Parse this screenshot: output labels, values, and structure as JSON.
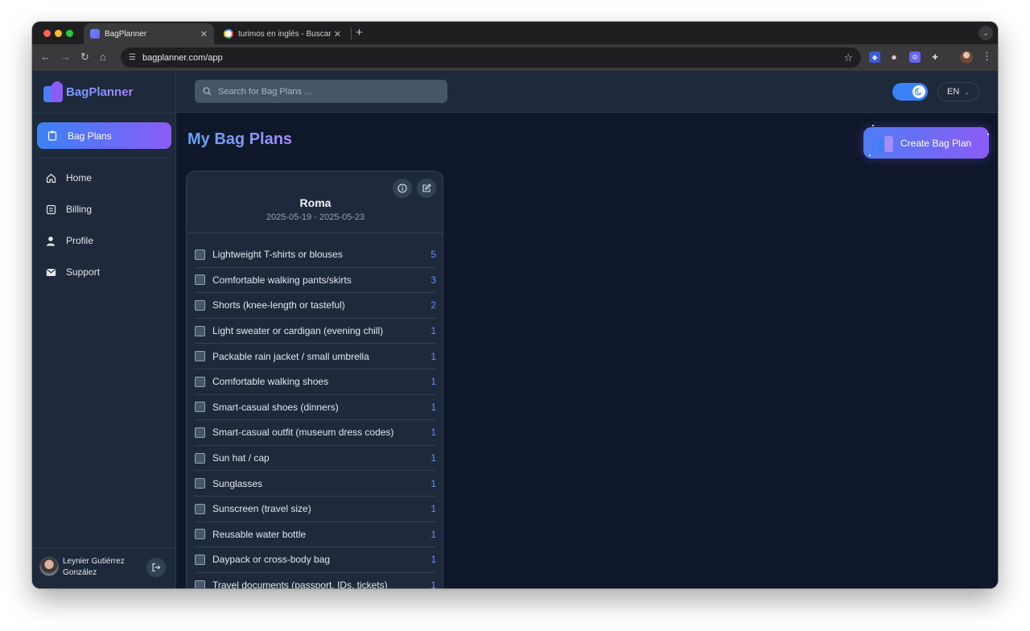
{
  "browser": {
    "tabs": [
      {
        "title": "BagPlanner",
        "active": true
      },
      {
        "title": "turimos en inglés - Buscar co",
        "active": false
      }
    ],
    "url": "bagplanner.com/app"
  },
  "brand": {
    "name": "BagPlanner"
  },
  "sidebar": {
    "active": {
      "label": "Bag Plans",
      "icon": "clipboard-icon"
    },
    "items": [
      {
        "label": "Home",
        "icon": "home-icon"
      },
      {
        "label": "Billing",
        "icon": "receipt-icon"
      },
      {
        "label": "Profile",
        "icon": "user-icon"
      },
      {
        "label": "Support",
        "icon": "envelope-icon"
      }
    ],
    "user": {
      "name": "Leynier Gutiérrez González"
    }
  },
  "header": {
    "search_placeholder": "Search for Bag Plans ...",
    "theme_toggle": "dark",
    "language": "EN"
  },
  "main": {
    "title": "My Bag Plans",
    "create_label": "Create Bag Plan"
  },
  "plan": {
    "title": "Roma",
    "dates": "2025-05-19 - 2025-05-23",
    "items": [
      {
        "label": "Lightweight T-shirts or blouses",
        "qty": "5"
      },
      {
        "label": "Comfortable walking pants/skirts",
        "qty": "3"
      },
      {
        "label": "Shorts (knee-length or tasteful)",
        "qty": "2"
      },
      {
        "label": "Light sweater or cardigan (evening chill)",
        "qty": "1"
      },
      {
        "label": "Packable rain jacket / small umbrella",
        "qty": "1"
      },
      {
        "label": "Comfortable walking shoes",
        "qty": "1"
      },
      {
        "label": "Smart-casual shoes (dinners)",
        "qty": "1"
      },
      {
        "label": "Smart-casual outfit (museum dress codes)",
        "qty": "1"
      },
      {
        "label": "Sun hat / cap",
        "qty": "1"
      },
      {
        "label": "Sunglasses",
        "qty": "1"
      },
      {
        "label": "Sunscreen (travel size)",
        "qty": "1"
      },
      {
        "label": "Reusable water bottle",
        "qty": "1"
      },
      {
        "label": "Daypack or cross-body bag",
        "qty": "1"
      },
      {
        "label": "Travel documents (passport, IDs, tickets)",
        "qty": "1"
      }
    ]
  },
  "colors": {
    "accent_start": "#3b82f6",
    "accent_end": "#8b5cf6",
    "background": "#0f172a",
    "surface": "#1e293b"
  }
}
